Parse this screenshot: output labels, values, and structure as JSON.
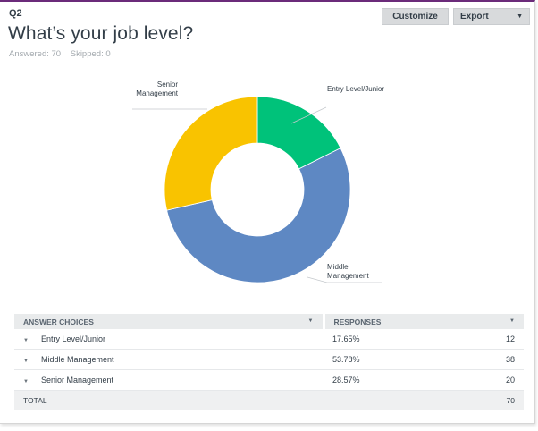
{
  "question": {
    "number": "Q2",
    "title": "What’s your job level?",
    "answered": "Answered: 70",
    "skipped": "Skipped: 0"
  },
  "toolbar": {
    "customize_label": "Customize",
    "export_label": "Export"
  },
  "chart_data": {
    "type": "pie",
    "donut": true,
    "categories": [
      "Entry Level/Junior",
      "Middle Management",
      "Senior Management"
    ],
    "values": [
      17.65,
      53.78,
      28.57
    ],
    "colors": [
      "#00c27a",
      "#5e88c3",
      "#f9c300"
    ],
    "label_lines": [
      [
        "Entry Level/Junior"
      ],
      [
        "Middle",
        "Management"
      ],
      [
        "Senior",
        "Management"
      ]
    ]
  },
  "table": {
    "headers": [
      "ANSWER CHOICES",
      "RESPONSES"
    ],
    "rows": [
      {
        "choice": "Entry Level/Junior",
        "percent": "17.65%",
        "count": "12"
      },
      {
        "choice": "Middle Management",
        "percent": "53.78%",
        "count": "38"
      },
      {
        "choice": "Senior Management",
        "percent": "28.57%",
        "count": "20"
      }
    ],
    "total_label": "TOTAL",
    "total_count": "70"
  }
}
